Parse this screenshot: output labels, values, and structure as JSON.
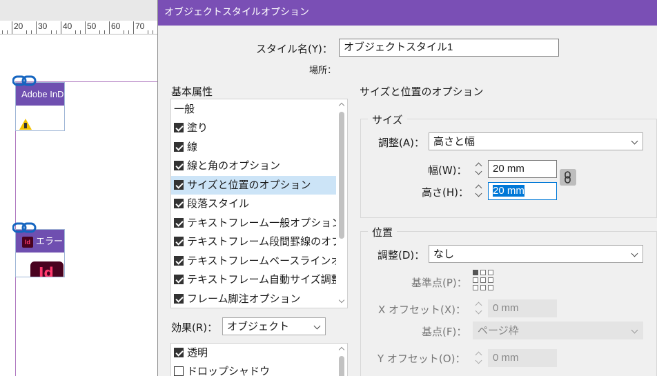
{
  "ruler": {
    "marks": [
      "20",
      "30",
      "40",
      "50",
      "60",
      "70"
    ]
  },
  "canvas": {
    "frame1_label": "Adobe InD",
    "frame2_label": "エラーレ",
    "frame2_icon": "Id",
    "frame2_big_icon": "Id"
  },
  "dialog": {
    "title": "オブジェクトスタイルオプション",
    "style_name_label": "スタイル名(Y)：",
    "style_name_value": "オブジェクトスタイル1",
    "location_label": "場所：",
    "basic_attributes_label": "基本属性",
    "attributes": [
      {
        "label": "一般",
        "has_checkbox": false,
        "checked": false,
        "selected": false
      },
      {
        "label": "塗り",
        "has_checkbox": true,
        "checked": true,
        "selected": false
      },
      {
        "label": "線",
        "has_checkbox": true,
        "checked": true,
        "selected": false
      },
      {
        "label": "線と角のオプション",
        "has_checkbox": true,
        "checked": true,
        "selected": false
      },
      {
        "label": "サイズと位置のオプション",
        "has_checkbox": true,
        "checked": true,
        "selected": true
      },
      {
        "label": "段落スタイル",
        "has_checkbox": true,
        "checked": true,
        "selected": false
      },
      {
        "label": "テキストフレーム一般オプション",
        "has_checkbox": true,
        "checked": true,
        "selected": false
      },
      {
        "label": "テキストフレーム段間罫線のオプション",
        "has_checkbox": true,
        "checked": true,
        "selected": false
      },
      {
        "label": "テキストフレームベースラインオプション",
        "has_checkbox": true,
        "checked": true,
        "selected": false
      },
      {
        "label": "テキストフレーム自動サイズ調整オプション",
        "has_checkbox": true,
        "checked": true,
        "selected": false
      },
      {
        "label": "フレーム脚注オプション",
        "has_checkbox": true,
        "checked": true,
        "selected": false
      }
    ],
    "effects_label": "効果(R)：",
    "effects_value": "オブジェクト",
    "effects": [
      {
        "label": "透明",
        "checked": true
      },
      {
        "label": "ドロップシャドウ",
        "checked": false
      }
    ],
    "panel_title": "サイズと位置のオプション",
    "size_group_title": "サイズ",
    "size_adjust_label": "調整(A)：",
    "size_adjust_value": "高さと幅",
    "width_label": "幅(W)：",
    "width_value": "20 mm",
    "height_label": "高さ(H)：",
    "height_value": "20 mm",
    "position_group_title": "位置",
    "position_adjust_label": "調整(D)：",
    "position_adjust_value": "なし",
    "reference_point_label": "基準点(P)：",
    "x_offset_label": "X オフセット(X)：",
    "x_offset_value": "0 mm",
    "x_origin_label": "基点(F)：",
    "x_origin_value": "ページ枠",
    "y_offset_label": "Y オフセット(O)：",
    "y_offset_value": "0 mm"
  },
  "colors": {
    "titlebar": "#7a4fb5",
    "frame_bar": "#6f4fb0",
    "selection": "#cce4f7",
    "focus": "#0078d7"
  }
}
